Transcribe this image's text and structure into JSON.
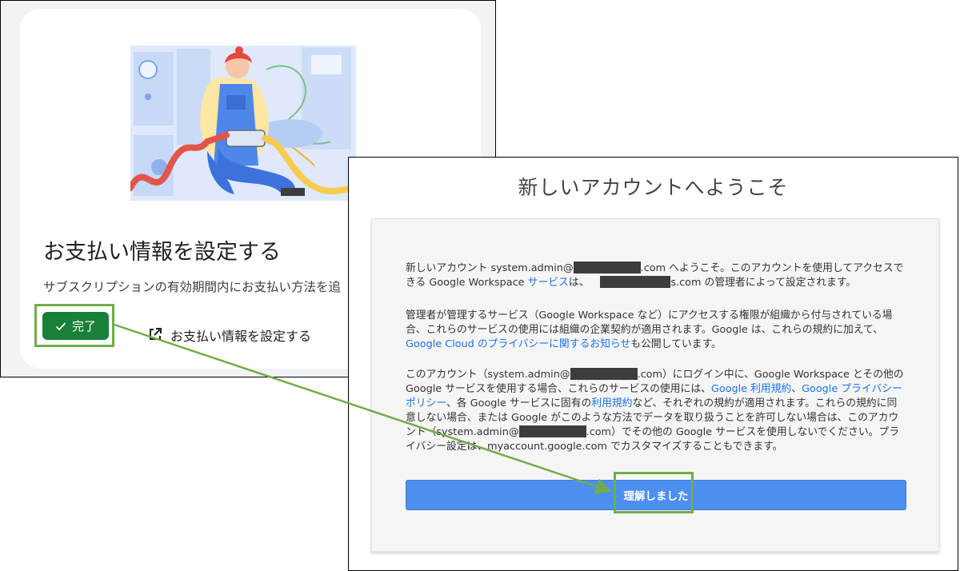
{
  "payment_setup": {
    "title": "お支払い情報を設定する",
    "description": "サブスクリプションの有効期間内にお支払い方法を追",
    "done_label": "完了",
    "link_label": "お支払い情報を設定する",
    "icons": [
      "checkmark-icon",
      "external-link-icon"
    ],
    "done_color": "#188038"
  },
  "welcome": {
    "heading": "新しいアカウントへようこそ",
    "p1": {
      "a": "新しいアカウント system.admin@",
      "b": ".com へようこそ。このアカウントを使用してアクセスできる Google Workspace ",
      "link": "サービス",
      "c": "は、",
      "d": "s.com の管理者によって設定されます。"
    },
    "p2": {
      "a": "管理者が管理するサービス（Google Workspace など）にアクセスする権限が組織から付与されている場合、これらのサービスの使用には組織の企業契約が適用されます。Google は、これらの規約に加えて、",
      "link": "Google Cloud のプライバシーに関するお知らせ",
      "b": "も公開しています。"
    },
    "p3": {
      "a": "このアカウント（system.admin@",
      "b": ".com）にログイン中に、Google Workspace とその他の Google サービスを使用する場合、これらのサービスの使用には、",
      "link1": "Google 利用規約",
      "c": "、",
      "link2": "Google プライバシー ポリシー",
      "d": "、各 Google サービスに固有の",
      "link3": "利用規約",
      "e": "など、それぞれの規約が適用されます。これらの規約に同意しない場合、または Google がこのような方法でデータを取り扱うことを許可しない場合は、このアカウント（system.admin@",
      "f": ".com）でその他の Google サービスを使用しないでください。プライバシー設定は、myaccount.google.com でカスタマイズすることもできます。"
    },
    "button_label": "理解しました",
    "button_color": "#4d8fee",
    "link_color": "#1a73e8"
  },
  "annotations": {
    "highlight_color": "#70ad47"
  }
}
